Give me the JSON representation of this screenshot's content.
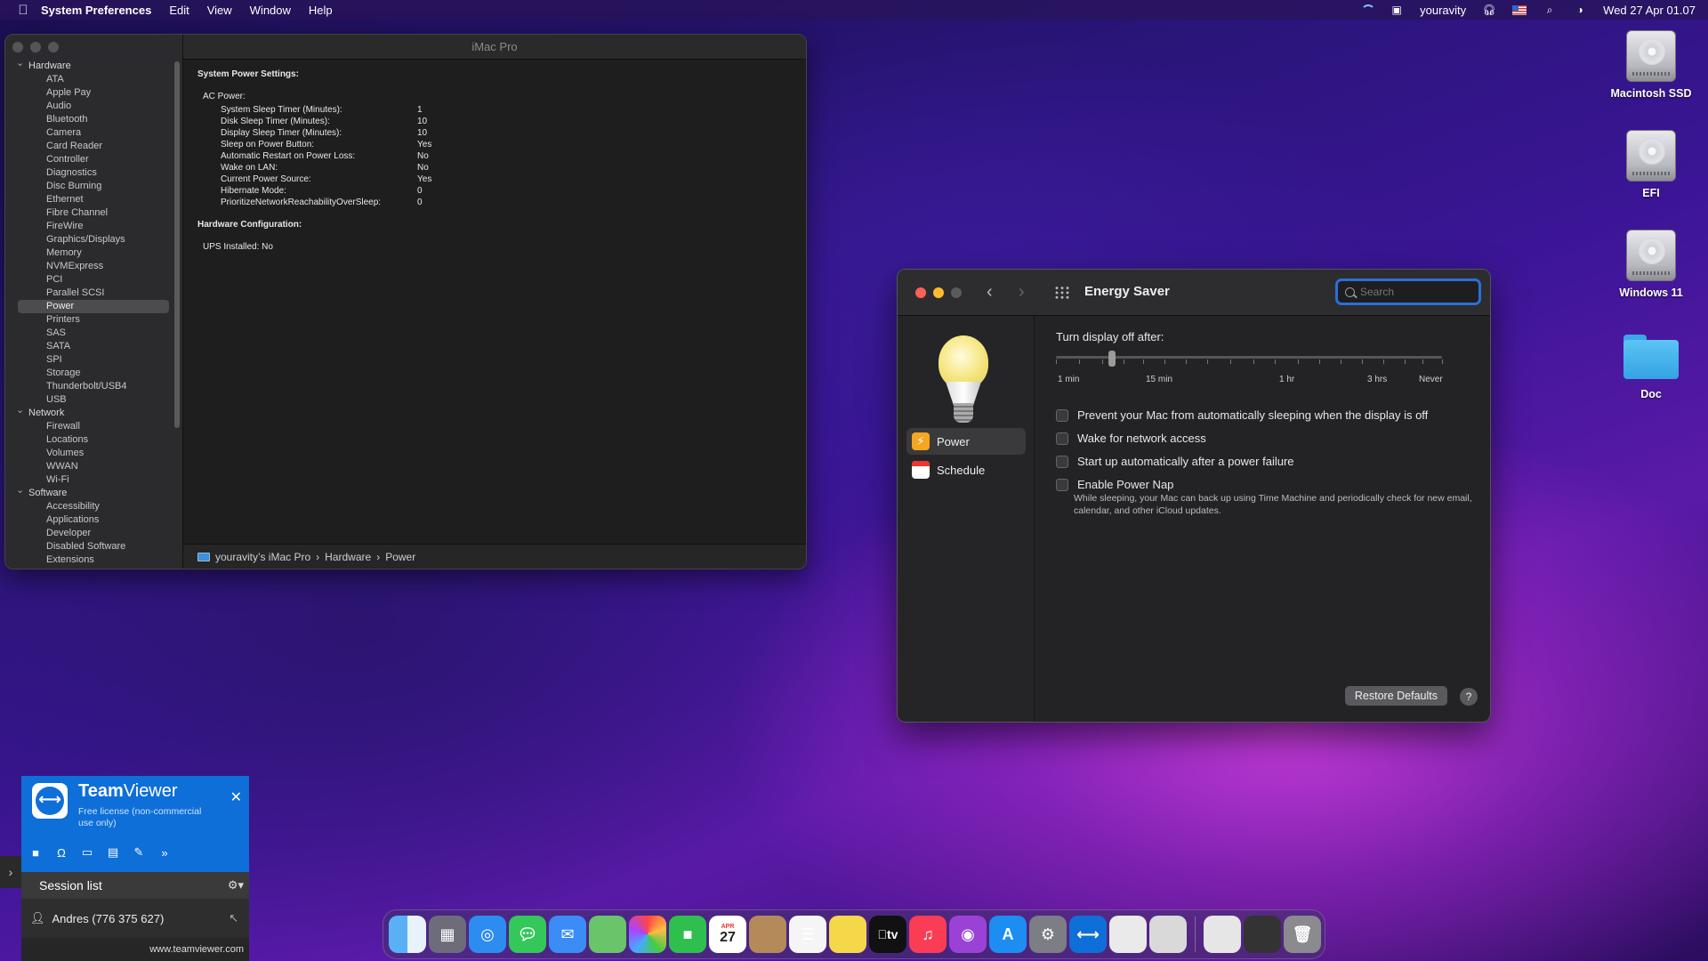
{
  "menubar": {
    "app_name": "System Preferences",
    "items": [
      "Edit",
      "View",
      "Window",
      "Help"
    ],
    "user": "youravity",
    "datetime": "Wed 27 Apr  01.07"
  },
  "sysinfo": {
    "window_title": "iMac Pro",
    "sidebar": {
      "groups": [
        {
          "label": "Hardware",
          "items": [
            "ATA",
            "Apple Pay",
            "Audio",
            "Bluetooth",
            "Camera",
            "Card Reader",
            "Controller",
            "Diagnostics",
            "Disc Burning",
            "Ethernet",
            "Fibre Channel",
            "FireWire",
            "Graphics/Displays",
            "Memory",
            "NVMExpress",
            "PCI",
            "Parallel SCSI",
            "Power",
            "Printers",
            "SAS",
            "SATA",
            "SPI",
            "Storage",
            "Thunderbolt/USB4",
            "USB"
          ]
        },
        {
          "label": "Network",
          "items": [
            "Firewall",
            "Locations",
            "Volumes",
            "WWAN",
            "Wi-Fi"
          ]
        },
        {
          "label": "Software",
          "items": [
            "Accessibility",
            "Applications",
            "Developer",
            "Disabled Software",
            "Extensions"
          ]
        }
      ],
      "selected": "Power"
    },
    "content": {
      "heading": "System Power Settings:",
      "section": "AC Power:",
      "rows": [
        {
          "k": "System Sleep Timer (Minutes):",
          "v": "1"
        },
        {
          "k": "Disk Sleep Timer (Minutes):",
          "v": "10"
        },
        {
          "k": "Display Sleep Timer (Minutes):",
          "v": "10"
        },
        {
          "k": "Sleep on Power Button:",
          "v": "Yes"
        },
        {
          "k": "Automatic Restart on Power Loss:",
          "v": "No"
        },
        {
          "k": "Wake on LAN:",
          "v": "No"
        },
        {
          "k": "Current Power Source:",
          "v": "Yes"
        },
        {
          "k": "Hibernate Mode:",
          "v": "0"
        },
        {
          "k": "PrioritizeNetworkReachabilityOverSleep:",
          "v": "0"
        }
      ],
      "hw_heading": "Hardware Configuration:",
      "ups": "UPS Installed:  No"
    },
    "path": {
      "computer": "youravity’s iMac Pro",
      "sep1": "›",
      "hardware": "Hardware",
      "sep2": "›",
      "power": "Power"
    }
  },
  "energy": {
    "title": "Energy Saver",
    "search_placeholder": "Search",
    "sidebar": {
      "power": "Power",
      "schedule": "Schedule"
    },
    "slider_label": "Turn display off after:",
    "slider_value_minutes": 10,
    "tick_labels": [
      "1 min",
      "15 min",
      "1 hr",
      "3 hrs",
      "Never"
    ],
    "checkboxes": [
      {
        "label": "Prevent your Mac from automatically sleeping when the display is off",
        "checked": false
      },
      {
        "label": "Wake for network access",
        "checked": false
      },
      {
        "label": "Start up automatically after a power failure",
        "checked": false
      },
      {
        "label": "Enable Power Nap",
        "checked": false
      }
    ],
    "power_nap_desc": "While sleeping, your Mac can back up using Time Machine and periodically check for new email, calendar, and other iCloud updates.",
    "restore": "Restore Defaults",
    "help": "?"
  },
  "desktop_icons": [
    "Macintosh SSD",
    "EFI",
    "Windows 11",
    "Doc"
  ],
  "teamviewer": {
    "brand_bold": "Team",
    "brand_light": "Viewer",
    "license": "Free license (non-commercial use only)",
    "session_list": "Session list",
    "contact": "Andres (776 375 627)",
    "footer": "www.teamviewer.com"
  },
  "dock": {
    "calendar_month": "APR",
    "calendar_day": "27",
    "tv_label": "tv",
    "apps": [
      "finder-icon",
      "launchpad-icon",
      "safari-icon",
      "messages-icon",
      "mail-icon",
      "maps-icon",
      "photos-icon",
      "facetime-icon",
      "calendar-icon",
      "contacts-icon",
      "reminders-icon",
      "notes-icon",
      "appletv-icon",
      "music-icon",
      "podcasts-icon",
      "appstore-icon",
      "system-preferences-icon",
      "teamviewer-icon",
      "textedit-icon",
      "printer-icon",
      "document-icon",
      "screen-icon",
      "trash-icon"
    ]
  }
}
